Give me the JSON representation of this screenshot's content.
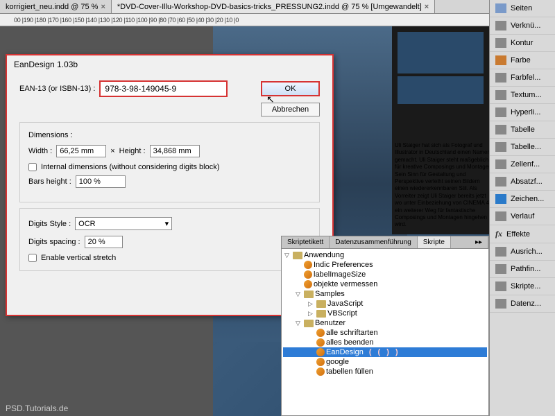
{
  "tabs": [
    {
      "label": "korrigiert_neu.indd @ 75 %",
      "close": "×"
    },
    {
      "label": "*DVD-Cover-Illu-Workshop-DVD-basics-tricks_PRESSUNG2.indd @ 75 % [Umgewandelt]",
      "close": "×"
    }
  ],
  "ruler": "00 |190 |180 |170 |160 |150 |140 |130 |120 |110 |100 |90 |80 |70 |60 |50 |40 |30 |20 |10 |0",
  "text_block": "Uli Staiger hat sich als Fotograf und Illustrator in Deutschland einen Namen gemacht. Uli Staiger steht maßgeblich für kreative Composings und Montagen. Sein Sinn für Gestaltung und Perspektive verleiht seinen Bildern einen wiedererkennbaren Stil. Als Vorreiter zeigt Uli Staiger bereits jetzt wo unter Einbeziehung von CINEMA 4D ein weiterer Weg für fantastische Composings und Montagen hingehen wird.",
  "dialog": {
    "title": "EanDesign 1.03b",
    "ean_label": "EAN-13 (or ISBN-13) :",
    "ean_value": "978-3-98-149045-9",
    "ok": "OK",
    "cancel": "Abbrechen",
    "dimensions": "Dimensions :",
    "width_label": "Width :",
    "width_value": "66,25 mm",
    "times": "×",
    "height_label": "Height :",
    "height_value": "34,868 mm",
    "internal": "Internal dimensions (without considering digits block)",
    "bars_label": "Bars height :",
    "bars_value": "100 %",
    "digits_style_label": "Digits Style :",
    "digits_style_value": "OCR",
    "digits_spacing_label": "Digits spacing :",
    "digits_spacing_value": "20 %",
    "enable_stretch": "Enable vertical stretch"
  },
  "scripts": {
    "tab1": "Skriptetikett",
    "tab2": "Datenzusammenführung",
    "tab3": "Skripte",
    "root": "Anwendung",
    "items1": [
      "Indic Preferences",
      "labelImageSize",
      "objekte vermessen"
    ],
    "samples": "Samples",
    "samples_items": [
      "JavaScript",
      "VBScript"
    ],
    "benutzer": "Benutzer",
    "user_items": [
      "alle schriftarten",
      "alles beenden",
      "EanDesign",
      "google",
      "tabellen füllen"
    ],
    "parens": "( ( ) )"
  },
  "dock": [
    "Seiten",
    "Verknü...",
    "Kontur",
    "Farbe",
    "Farbfel...",
    "Textum...",
    "Hyperli...",
    "Tabelle",
    "Tabelle...",
    "Zellenf...",
    "Absatzf...",
    "Zeichen...",
    "Verlauf",
    "Effekte",
    "Ausrich...",
    "Pathfin...",
    "Skripte...",
    "Datenz..."
  ],
  "dock_icons": [
    "#7a9ac9",
    "#888",
    "#888",
    "#c97a30",
    "#888",
    "#888",
    "#888",
    "#888",
    "#888",
    "#888",
    "#888",
    "#2a7ac9",
    "#888",
    "fx",
    "#888",
    "#888",
    "#888",
    "#888"
  ],
  "bottom": "PSD.Tutorials.de"
}
